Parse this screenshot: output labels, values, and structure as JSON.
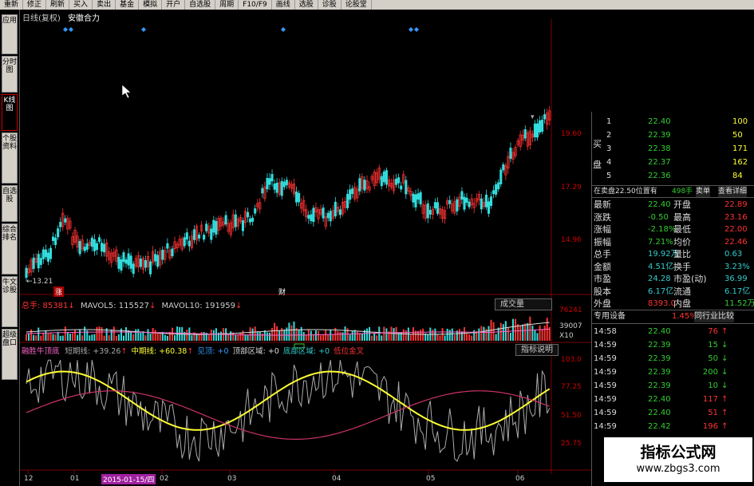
{
  "menubar": [
    "重新",
    "修正",
    "刷新",
    "买入",
    "卖出",
    "基金",
    "模拟",
    "开户",
    "自选股",
    "周期",
    "F10/F9",
    "画线",
    "选股",
    "诊股",
    "论股堂"
  ],
  "left_tabs": [
    "应用",
    "分时图",
    "K线图",
    "个股资料",
    "自选股",
    "综合排名",
    "牛文诊股",
    "超级盘口"
  ],
  "chart": {
    "header": "日线(复权)",
    "indicator_name": "安徽合力",
    "price_labels": [
      "19.60",
      "17.29",
      "14.96"
    ],
    "low_label": "13.21",
    "tag_zhang": "涨",
    "tag_cai": "财"
  },
  "volume": {
    "total_label": "总手: 85381",
    "mavol5": "MAVOL5: 115527",
    "mavol10": "MAVOL10: 191959",
    "button": "成交量",
    "labels": [
      "76241",
      "39007",
      "X10"
    ]
  },
  "indicator": {
    "name": "融胜牛顶底",
    "short": "短期线: +39.26",
    "mid": "中期线: +60.38",
    "see_top": "见顶: +0",
    "top_zone": "顶部区域: +0",
    "bottom_zone": "底部区域: +0",
    "low_cross": "低位金叉",
    "button": "指标说明",
    "labels": [
      "103.0",
      "77.25",
      "51.50",
      "25.75"
    ]
  },
  "xaxis": [
    "12",
    "01",
    "2015-01-15/四",
    "02",
    "03",
    "04",
    "05",
    "06"
  ],
  "orderbook": {
    "side_buy": "买盘",
    "rows": [
      {
        "lvl": "1",
        "price": "22.40",
        "vol": "100"
      },
      {
        "lvl": "2",
        "price": "22.39",
        "vol": "50"
      },
      {
        "lvl": "3",
        "price": "22.38",
        "vol": "171"
      },
      {
        "lvl": "4",
        "price": "22.37",
        "vol": "162"
      },
      {
        "lvl": "5",
        "price": "22.36",
        "vol": "84"
      }
    ],
    "status": "在卖盘22.50位置有",
    "status_vol": "498手",
    "status_btn1": "卖单",
    "status_btn2": "查看详细"
  },
  "stats": [
    {
      "k1": "最新",
      "v1": "22.40",
      "k2": "开盘",
      "v2": "22.89"
    },
    {
      "k1": "涨跌",
      "v1": "-0.50",
      "k2": "最高",
      "v2": "23.16"
    },
    {
      "k1": "涨幅",
      "v1": "-2.18%",
      "k2": "最低",
      "v2": "22.00"
    },
    {
      "k1": "振幅",
      "v1": "7.21%",
      "k2": "均价",
      "v2": "22.46"
    },
    {
      "k1": "总手",
      "v1": "19.92万",
      "k2": "量比",
      "v2": "0.63"
    },
    {
      "k1": "金额",
      "v1": "4.51亿",
      "k2": "换手",
      "v2": "3.23%"
    },
    {
      "k1": "市盈",
      "v1": "24.28",
      "k2": "市盈(动)",
      "v2": "36.99"
    },
    {
      "k1": "股本",
      "v1": "6.17亿",
      "k2": "流通",
      "v2": "6.17亿"
    },
    {
      "k1": "外盘",
      "v1": "8393.0",
      "k2": "内盘",
      "v2": "11.52万"
    }
  ],
  "tabs": {
    "left": "专用设备",
    "pct": "1.45%",
    "right": "同行业比较"
  },
  "ticks": [
    {
      "t": "14:58",
      "p": "22.40",
      "v": "76",
      "dir": "up"
    },
    {
      "t": "14:59",
      "p": "22.39",
      "v": "15",
      "dir": "down"
    },
    {
      "t": "14:59",
      "p": "22.39",
      "v": "50",
      "dir": "down"
    },
    {
      "t": "14:59",
      "p": "22.39",
      "v": "200",
      "dir": "down"
    },
    {
      "t": "14:59",
      "p": "22.39",
      "v": "10",
      "dir": "down"
    },
    {
      "t": "14:59",
      "p": "22.40",
      "v": "117",
      "dir": "up"
    },
    {
      "t": "14:59",
      "p": "22.40",
      "v": "51",
      "dir": "up"
    },
    {
      "t": "14:59",
      "p": "22.42",
      "v": "196",
      "dir": "up"
    }
  ],
  "watermark": {
    "line1": "指标公式网",
    "line2": "www.zbgs3.com"
  }
}
